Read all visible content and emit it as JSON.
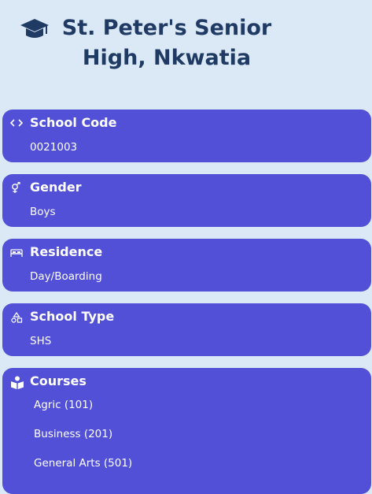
{
  "school": {
    "name": "St. Peter's Senior High, Nkwatia"
  },
  "cards": [
    {
      "label": "School Code",
      "value": "0021003",
      "icon": "code-icon"
    },
    {
      "label": "Gender",
      "value": "Boys",
      "icon": "gender-icon"
    },
    {
      "label": "Residence",
      "value": "Day/Boarding",
      "icon": "bed-icon"
    },
    {
      "label": "School Type",
      "value": "SHS",
      "icon": "shapes-icon"
    }
  ],
  "courses": {
    "label": "Courses",
    "icon": "book-reader-icon",
    "items": [
      "Agric (101)",
      "Business (201)",
      "General Arts (501)"
    ]
  },
  "colors": {
    "background": "#dbe9f7",
    "card": "#5150d6",
    "title": "#1f3a63"
  }
}
